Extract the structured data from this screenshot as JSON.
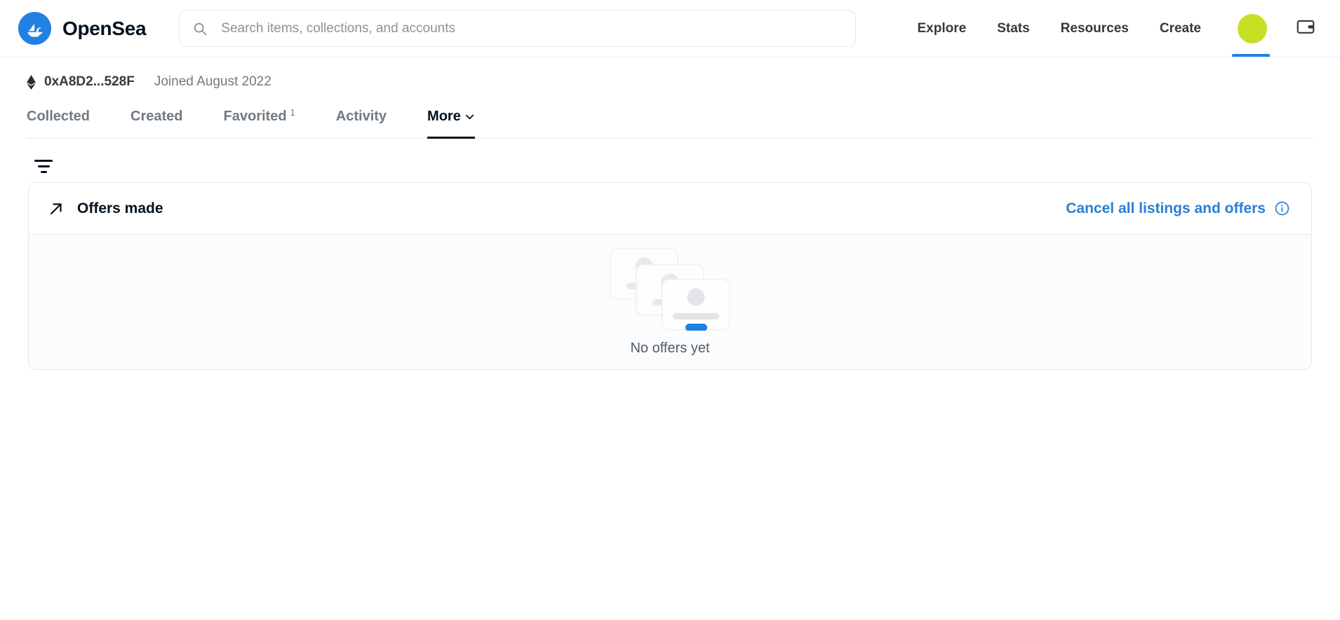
{
  "header": {
    "brand_name": "OpenSea",
    "brand_logo_icon": "opensea-ship-logo",
    "search": {
      "icon": "search-icon",
      "placeholder": "Search items, collections, and accounts",
      "value": ""
    },
    "nav_links": [
      {
        "label": "Explore"
      },
      {
        "label": "Stats"
      },
      {
        "label": "Resources"
      },
      {
        "label": "Create"
      }
    ],
    "avatar": {
      "icon": "avatar",
      "color": "#c8e023",
      "active": true
    },
    "wallet_icon": "wallet-icon",
    "active_indicator_color": "#2081e2"
  },
  "profile": {
    "chain_icon": "ethereum-icon",
    "wallet_address": "0xA8D2...528F",
    "joined": "Joined August 2022"
  },
  "tabs": [
    {
      "label": "Collected",
      "badge": "",
      "active": false,
      "chevron": false
    },
    {
      "label": "Created",
      "badge": "",
      "active": false,
      "chevron": false
    },
    {
      "label": "Favorited",
      "badge": "1",
      "active": false,
      "chevron": false
    },
    {
      "label": "Activity",
      "badge": "",
      "active": false,
      "chevron": false
    },
    {
      "label": "More",
      "badge": "",
      "active": true,
      "chevron": true
    }
  ],
  "toolbar": {
    "filter_icon": "filter-icon"
  },
  "offers_card": {
    "icon": "arrow-up-right-icon",
    "title": "Offers made",
    "cancel_link_label": "Cancel all listings and offers",
    "cancel_link_color": "#2a7fd4",
    "info_icon": "info-circle-icon",
    "empty_state": {
      "illustration": "stacked-cards-illustration",
      "text": "No offers yet",
      "accent_color": "#2081e2"
    }
  }
}
